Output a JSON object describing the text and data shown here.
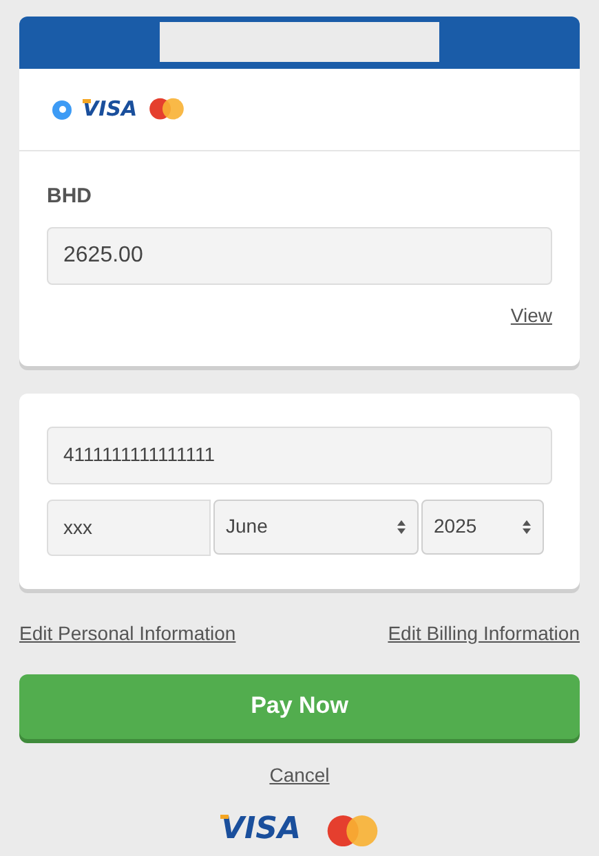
{
  "payment_methods": [
    {
      "selected": true,
      "logos": [
        {
          "kind": "visa",
          "text": "VISA"
        },
        {
          "kind": "mastercard"
        }
      ]
    }
  ],
  "amount": {
    "currency": "BHD",
    "value": "2625.00",
    "link": "View"
  },
  "card": {
    "number": "4111111111111111",
    "cvv": "xxx",
    "month": "June",
    "year": "2025"
  },
  "links": [
    "Edit Personal Information",
    "Edit Billing Information"
  ],
  "pay_button": "Pay Now",
  "cancel": "Cancel",
  "footer_logos": [
    {
      "kind": "visa",
      "text": "VISA"
    },
    {
      "kind": "mastercard"
    }
  ]
}
